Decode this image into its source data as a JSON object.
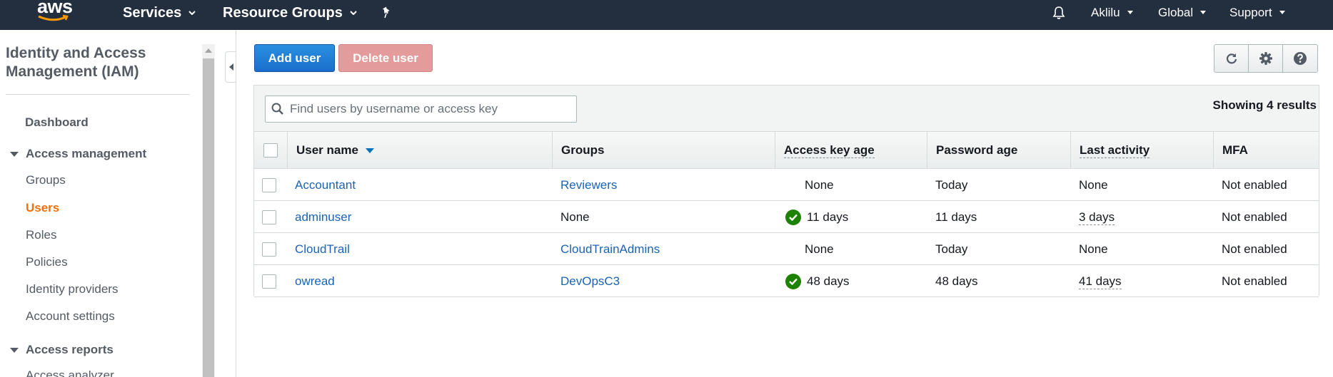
{
  "nav": {
    "logo_text": "aws",
    "services": "Services",
    "resource_groups": "Resource Groups",
    "user": "Aklilu",
    "region": "Global",
    "support": "Support",
    "icons": [
      "pin-icon",
      "bell-icon",
      "chevron-down-icon"
    ]
  },
  "sidebar": {
    "title": "Identity and Access Management (IAM)",
    "dashboard": "Dashboard",
    "access_management": "Access management",
    "items": [
      "Groups",
      "Users",
      "Roles",
      "Policies",
      "Identity providers",
      "Account settings"
    ],
    "active_item": "Users",
    "access_reports": "Access reports",
    "reports_items": [
      "Access analyzer"
    ]
  },
  "toolbar": {
    "add_user": "Add user",
    "delete_user": "Delete user",
    "icons": [
      "refresh-icon",
      "gear-icon",
      "help-icon"
    ]
  },
  "table": {
    "search_placeholder": "Find users by username or access key",
    "results_text": "Showing 4 results",
    "columns": [
      "User name",
      "Groups",
      "Access key age",
      "Password age",
      "Last activity",
      "MFA"
    ],
    "rows": [
      {
        "user": "Accountant",
        "groups": "Reviewers",
        "groups_link": true,
        "key_age": "None",
        "key_ok": false,
        "pwd_age": "Today",
        "last": "None",
        "last_link": false,
        "mfa": "Not enabled"
      },
      {
        "user": "adminuser",
        "groups": "None",
        "groups_link": false,
        "key_age": "11 days",
        "key_ok": true,
        "pwd_age": "11 days",
        "last": "3 days",
        "last_link": true,
        "mfa": "Not enabled"
      },
      {
        "user": "CloudTrail",
        "groups": "CloudTrainAdmins",
        "groups_link": true,
        "key_age": "None",
        "key_ok": false,
        "pwd_age": "Today",
        "last": "None",
        "last_link": false,
        "mfa": "Not enabled"
      },
      {
        "user": "owread",
        "groups": "DevOpsC3",
        "groups_link": true,
        "key_age": "48 days",
        "key_ok": true,
        "pwd_age": "48 days",
        "last": "41 days",
        "last_link": true,
        "mfa": "Not enabled"
      }
    ]
  },
  "colors": {
    "nav_bg": "#232f3e",
    "link": "#1b63b4",
    "active": "#ec7211",
    "primary": "#1a6fcc",
    "ok": "#1d8102"
  }
}
